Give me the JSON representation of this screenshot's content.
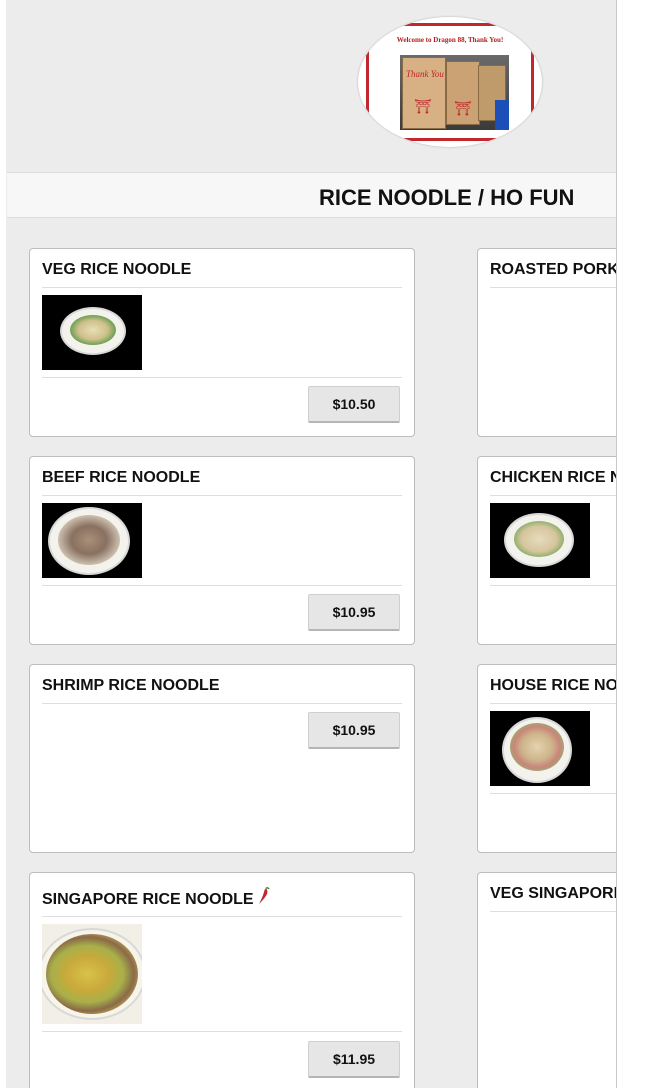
{
  "header": {
    "logo_text": "Welcome to Dragon 88, Thank You!",
    "logo_box_text": "Thank You"
  },
  "section": {
    "title": "RICE NOODLE / HO FUN"
  },
  "colors": {
    "background": "#ececec",
    "card": "#ffffff",
    "button": "#e6e6e6",
    "accent_red": "#c1272d"
  },
  "items": [
    {
      "name": "VEG RICE NOODLE",
      "price": "$10.50",
      "has_image": true,
      "spicy": false
    },
    {
      "name": "ROASTED PORK RICE NOODLE",
      "price": "",
      "has_image": false,
      "spicy": false
    },
    {
      "name": "BEEF RICE NOODLE",
      "price": "$10.95",
      "has_image": true,
      "spicy": false
    },
    {
      "name": "CHICKEN RICE NOODLE",
      "price": "",
      "has_image": true,
      "spicy": false
    },
    {
      "name": "SHRIMP RICE NOODLE",
      "price": "$10.95",
      "has_image": false,
      "spicy": false
    },
    {
      "name": "HOUSE RICE NOODLE",
      "price": "",
      "has_image": true,
      "spicy": false
    },
    {
      "name": "SINGAPORE RICE NOODLE",
      "price": "$11.95",
      "has_image": true,
      "spicy": true
    },
    {
      "name": "VEG SINGAPORE RICE NOODLE",
      "price": "",
      "has_image": false,
      "spicy": false
    }
  ]
}
